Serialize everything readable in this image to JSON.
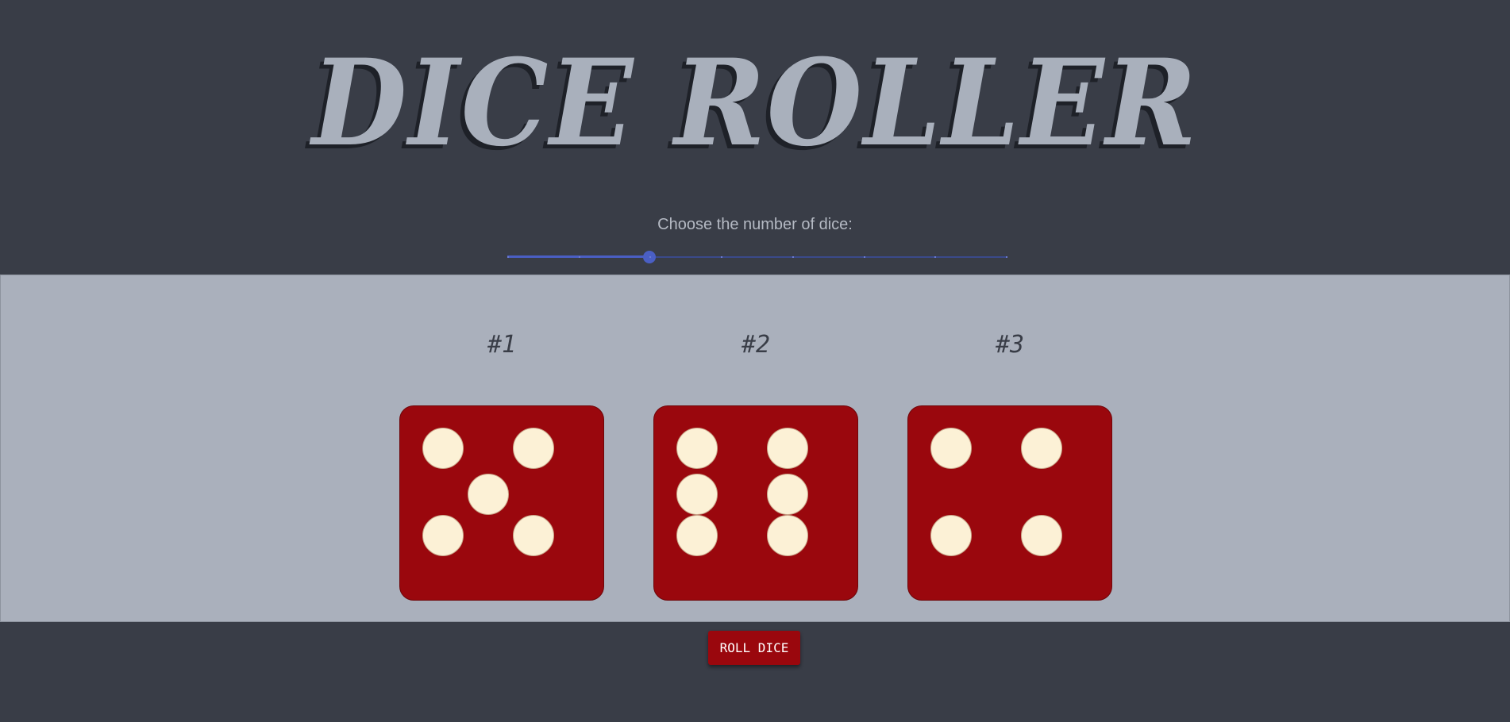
{
  "title": "DICE ROLLER",
  "slider": {
    "label": "Choose the number of dice:",
    "value": 3,
    "min": 1,
    "max": 8,
    "accent_color": "#4a5fc4"
  },
  "dice": [
    {
      "label": "#1",
      "value": 5
    },
    {
      "label": "#2",
      "value": 6
    },
    {
      "label": "#3",
      "value": 4
    }
  ],
  "colors": {
    "background": "#393d47",
    "board": "#aab0bc",
    "die": "#9a070d",
    "pip": "#fcf1d6"
  },
  "roll_button": {
    "label": "ROLL DICE"
  }
}
